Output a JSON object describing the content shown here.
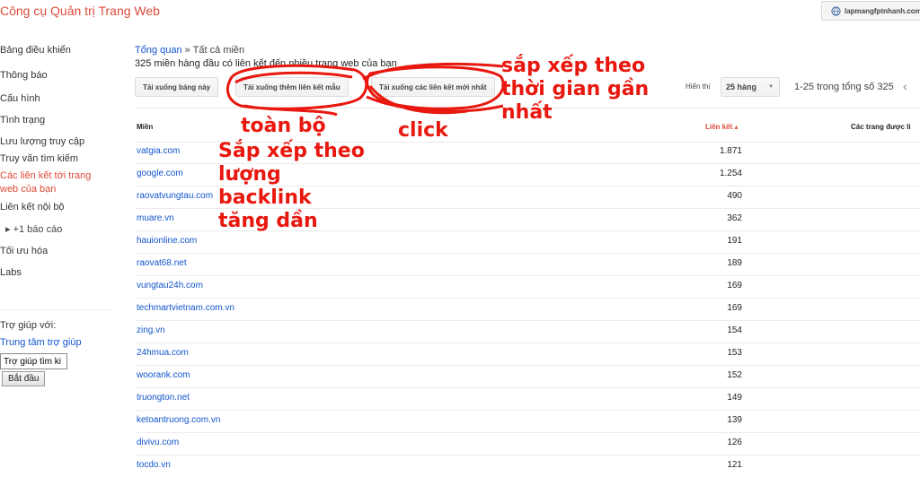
{
  "header": {
    "app_title": "Công cụ Quản trị Trang Web",
    "site_name": "lapmangfptnhanh.com"
  },
  "sidebar": {
    "items": [
      {
        "label": "Bảng điều khiển"
      },
      {
        "label": "Thông báo"
      },
      {
        "label": "Cấu hình"
      },
      {
        "label": "Tình trạng"
      },
      {
        "label": "Lưu lượng truy cập"
      },
      {
        "label": "Truy vấn tìm kiếm"
      },
      {
        "label": "Các liên kết tới trang web của bạn"
      },
      {
        "label": "Liên kết nội bộ"
      },
      {
        "label": "▸ +1 báo cáo"
      },
      {
        "label": "Tối ưu hóa"
      },
      {
        "label": "Labs"
      }
    ],
    "help_heading": "Trợ giúp với:",
    "help_center": "Trung tâm trợ giúp",
    "help_search_value": "Trợ giúp tìm ki",
    "start_button": "Bắt đầu"
  },
  "breadcrumb": {
    "overview": "Tổng quan",
    "separator": "»",
    "current": "Tất cả miền"
  },
  "subtitle": "325 miền hàng đầu có liên kết đến nhiều trang web của bạn",
  "toolbar": {
    "download_table": "Tải xuống bảng này",
    "download_more_samples": "Tải xuống thêm liên kết mẫu",
    "download_latest": "Tải xuống các liên kết mới nhất",
    "show_label": "Hiển thị",
    "show_value": "25 hàng",
    "page_info": "1-25 trong tổng số 325"
  },
  "table": {
    "headers": {
      "domain": "Miền",
      "links": "Liên kết ▴",
      "linked_pages": "Các trang được li"
    },
    "rows": [
      {
        "domain": "vatgia.com",
        "links": "1.871"
      },
      {
        "domain": "google.com",
        "links": "1.254"
      },
      {
        "domain": "raovatvungtau.com",
        "links": "490"
      },
      {
        "domain": "muare.vn",
        "links": "362"
      },
      {
        "domain": "hauionline.com",
        "links": "191"
      },
      {
        "domain": "raovat68.net",
        "links": "189"
      },
      {
        "domain": "vungtau24h.com",
        "links": "169"
      },
      {
        "domain": "techmartvietnam.com.vn",
        "links": "169"
      },
      {
        "domain": "zing.vn",
        "links": "154"
      },
      {
        "domain": "24hmua.com",
        "links": "153"
      },
      {
        "domain": "woorank.com",
        "links": "152"
      },
      {
        "domain": "truongton.net",
        "links": "149"
      },
      {
        "domain": "ketoantruong.com.vn",
        "links": "139"
      },
      {
        "domain": "divivu.com",
        "links": "126"
      },
      {
        "domain": "tocdo.vn",
        "links": "121"
      }
    ]
  },
  "annotations": {
    "all": "toàn bộ",
    "click": "click",
    "sort_backlinks": "Sắp xếp theo\nlượng\nbacklink\ntăng dần",
    "sort_recent": "sắp xếp theo\nthời gian gần\nnhất",
    "color": "#e8180f"
  },
  "colors": {
    "brand": "#dd4b39",
    "link": "#1155cc"
  }
}
